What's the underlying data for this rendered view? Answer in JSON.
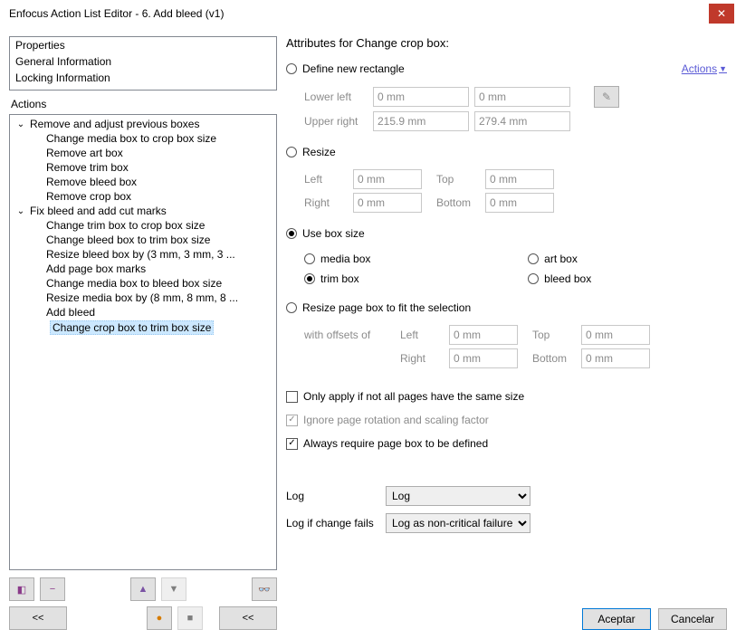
{
  "window": {
    "title": "Enfocus Action List Editor - 6. Add bleed (v1)"
  },
  "properties": {
    "items": [
      "Properties",
      "General Information",
      "Locking Information"
    ]
  },
  "actions_label": "Actions",
  "tree": {
    "group1": {
      "label": "Remove and adjust previous boxes",
      "children": [
        "Change media box to crop box size",
        "Remove art box",
        "Remove trim box",
        "Remove bleed box",
        "Remove crop box"
      ]
    },
    "group2": {
      "label": "Fix bleed and add cut marks",
      "children": [
        "Change trim box to crop box size",
        "Change bleed box to trim box size",
        "Resize bleed box by (3 mm, 3 mm, 3 ...",
        "Add page box marks",
        "Change media box to bleed box size",
        "Resize media box by (8 mm, 8 mm, 8 ...",
        "Add bleed",
        "Change crop box to trim box size"
      ]
    }
  },
  "right": {
    "title": "Attributes for Change crop box:",
    "actions_link": "Actions",
    "opt_define": "Define new rectangle",
    "define": {
      "lower_left_label": "Lower left",
      "upper_right_label": "Upper right",
      "ll_x": "0 mm",
      "ll_y": "0 mm",
      "ur_x": "215.9 mm",
      "ur_y": "279.4 mm"
    },
    "opt_resize": "Resize",
    "resize": {
      "left_label": "Left",
      "right_label": "Right",
      "top_label": "Top",
      "bottom_label": "Bottom",
      "left": "0 mm",
      "right": "0 mm",
      "top": "0 mm",
      "bottom": "0 mm"
    },
    "opt_usebox": "Use box size",
    "boxsize": {
      "media": "media box",
      "art": "art box",
      "trim": "trim box",
      "bleed": "bleed box"
    },
    "opt_fit": "Resize page box to fit the selection",
    "fit": {
      "prefix": "with offsets of",
      "left_label": "Left",
      "right_label": "Right",
      "top_label": "Top",
      "bottom_label": "Bottom",
      "left": "0 mm",
      "right": "0 mm",
      "top": "0 mm",
      "bottom": "0 mm"
    },
    "chk_only": "Only apply if not all pages have the same size",
    "chk_ignore": "Ignore page rotation and scaling factor",
    "chk_require": "Always require page box to be defined",
    "log_label": "Log",
    "log_value": "Log",
    "log_fail_label": "Log if change fails",
    "log_fail_value": "Log as non-critical failure"
  },
  "buttons": {
    "ok": "Aceptar",
    "cancel": "Cancelar",
    "prev": "<<",
    "prev2": "<<"
  }
}
